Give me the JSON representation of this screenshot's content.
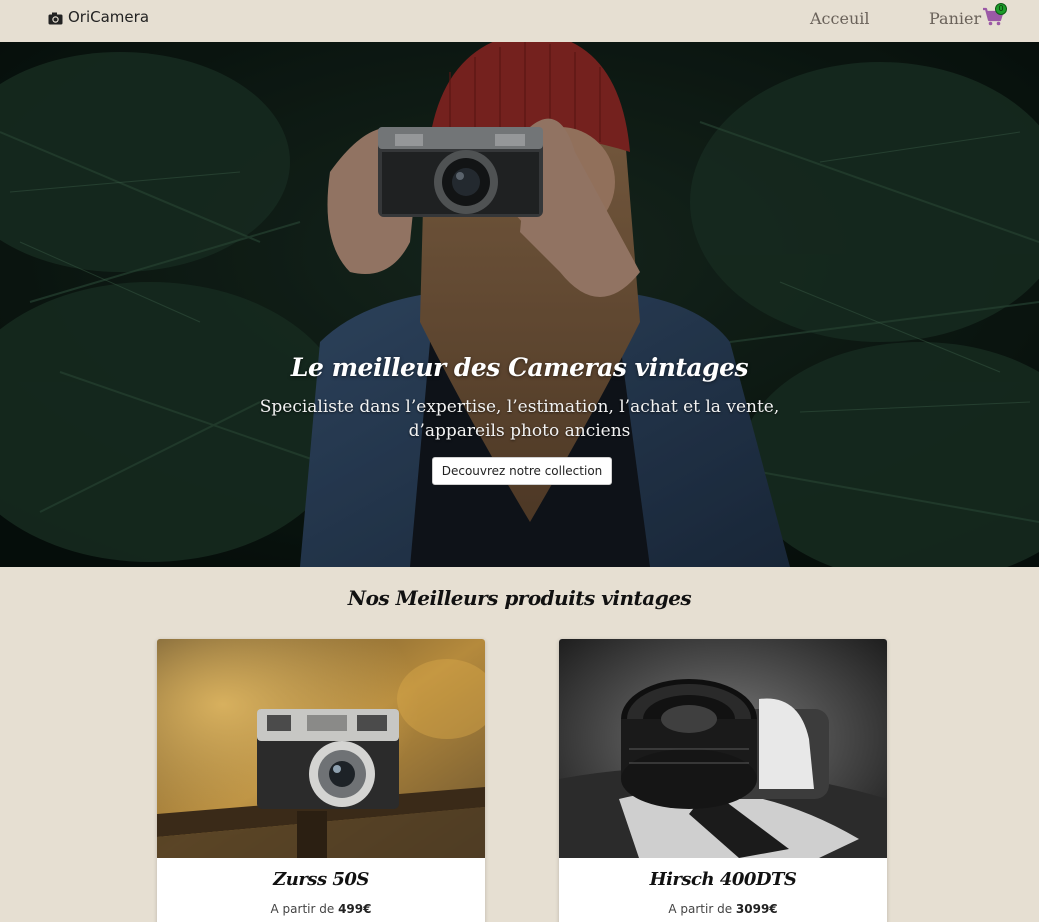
{
  "navbar": {
    "brand": "OriCamera",
    "brand_icon": "camera-icon",
    "links": [
      "Acceuil",
      "Panier"
    ],
    "cart_icon": "shopping-cart-icon",
    "cart_count": "0",
    "cart_icon_color": "#9b59a6",
    "badge_color": "#1d9d2b"
  },
  "hero": {
    "title": "Le meilleur des Cameras vintages",
    "subtitle_line1": "Specialiste dans l’expertise, l’estimation, l’achat et la vente,",
    "subtitle_line2": "d’appareils photo anciens",
    "button": "Decouvrez notre collection"
  },
  "products": {
    "title": "Nos Meilleurs produits vintages",
    "items": [
      {
        "name": "Zurss 50S",
        "price_prefix": "A partir de",
        "price": "499€"
      },
      {
        "name": "Hirsch 400DTS",
        "price_prefix": "A partir de",
        "price": "3099€"
      }
    ]
  },
  "colors": {
    "background": "#e6dfd2",
    "hero_dark": "#0f1d17",
    "text_dark": "#111111"
  }
}
